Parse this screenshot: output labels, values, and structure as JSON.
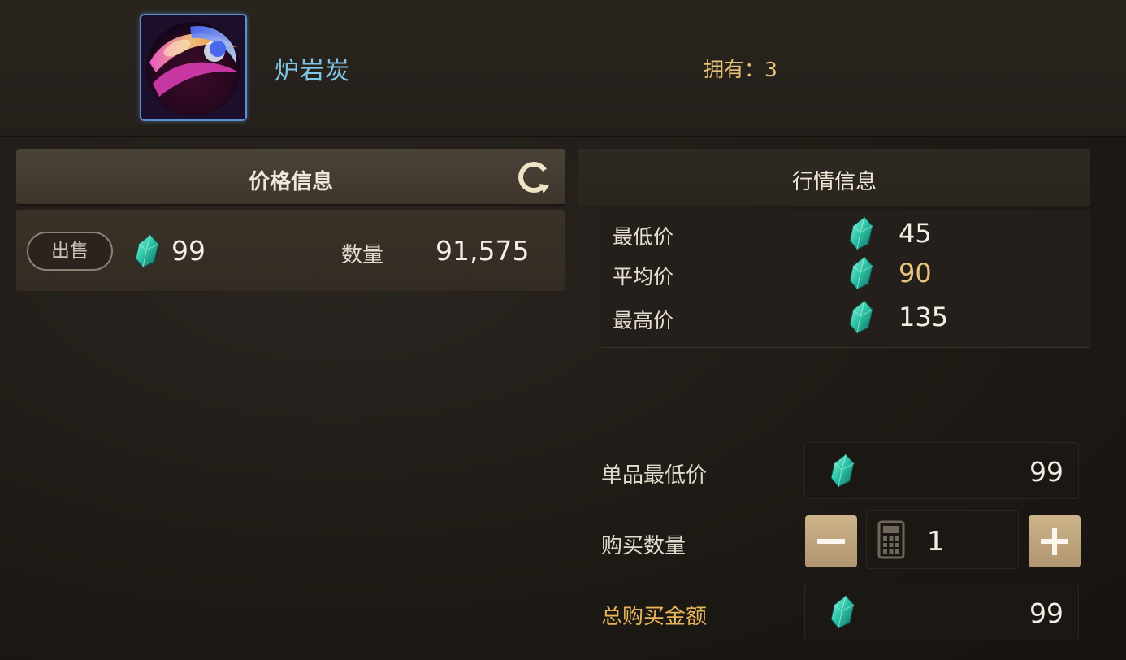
{
  "item": {
    "name": "炉岩炭",
    "owned_text": "拥有：3",
    "icon": "lava-orb-icon"
  },
  "price_panel": {
    "title": "价格信息",
    "refresh_icon": "refresh-icon",
    "listing": {
      "sell_label": "出售",
      "price": "99",
      "qty_label": "数量",
      "qty": "91,575"
    }
  },
  "market_panel": {
    "title": "行情信息",
    "rows": [
      {
        "label": "最低价",
        "value": "45"
      },
      {
        "label": "平均价",
        "value": "90"
      },
      {
        "label": "最高价",
        "value": "135"
      }
    ]
  },
  "purchase": {
    "unit_min_label": "单品最低价",
    "unit_min_value": "99",
    "qty_label": "购买数量",
    "qty_value": "1",
    "minus_icon": "minus-icon",
    "plus_icon": "plus-icon",
    "calculator_icon": "calculator-icon",
    "total_label": "总购买金额",
    "total_value": "99"
  },
  "colors": {
    "item_name": "#7fc6e6",
    "gold_text": "#e7c27a",
    "total_label": "#e9b55a",
    "gem": "#2fc7a8",
    "button_tan": "#c2a67c"
  },
  "currency_icon": "gem-icon"
}
